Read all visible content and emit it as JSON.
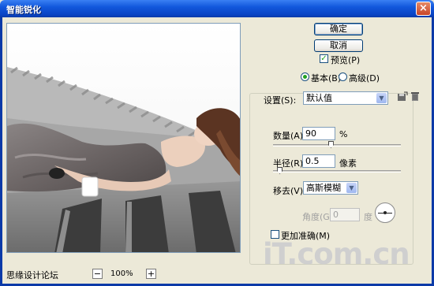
{
  "window": {
    "title": "智能锐化",
    "close_glyph": "×"
  },
  "buttons": {
    "ok": "确定",
    "cancel": "取消"
  },
  "preview": {
    "label": "预览(P)",
    "checked": true
  },
  "mode": {
    "basic": "基本(B)",
    "advanced": "高级(D)",
    "selected": "basic"
  },
  "settings": {
    "label": "设置(S):",
    "value": "默认值",
    "save_icon": "save-icon",
    "delete_icon": "trash-icon"
  },
  "amount": {
    "label": "数量(A):",
    "value": "90",
    "unit": "%",
    "slider_fraction": 0.45
  },
  "radius": {
    "label": "半径(R):",
    "value": "0.5",
    "unit": "像素",
    "slider_fraction": 0.05
  },
  "remove": {
    "label": "移去(V):",
    "value": "高斯模糊"
  },
  "angle": {
    "label": "角度(G):",
    "value": "0",
    "unit": "度"
  },
  "more_accurate": {
    "label": "更加准确(M)",
    "checked": false
  },
  "zoom": {
    "level": "100%",
    "minus": "−",
    "plus": "+"
  },
  "watermarks": {
    "left": "思缘设计论坛",
    "logo": "iT.com.cn"
  },
  "colors": {
    "titlebar": "#0a44c4",
    "face": "#ece9d8",
    "check_green": "#21a121"
  }
}
